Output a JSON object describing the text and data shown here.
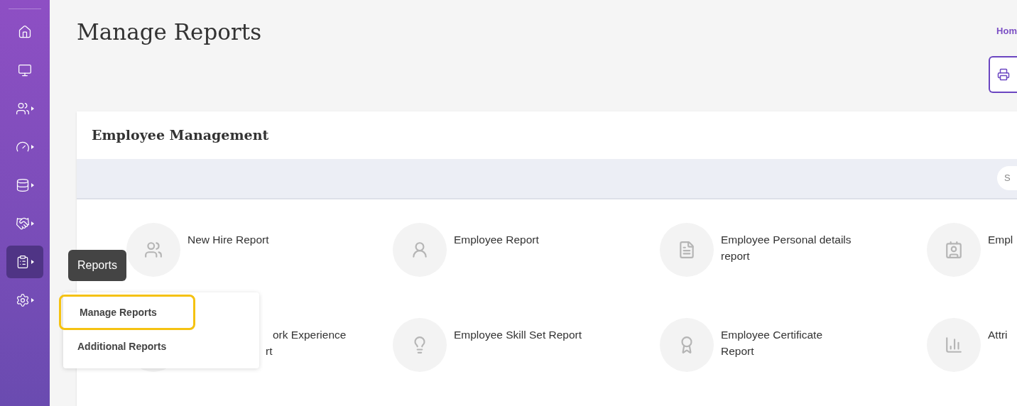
{
  "sidebar": {
    "items": [
      {
        "selected": false
      },
      {
        "selected": false
      },
      {
        "selected": false
      },
      {
        "selected": false
      },
      {
        "selected": false
      },
      {
        "selected": false
      },
      {
        "selected": true
      },
      {
        "selected": false
      }
    ]
  },
  "tooltip": "Reports",
  "flyout": {
    "items": [
      {
        "label": "Manage Reports",
        "selected": true
      },
      {
        "label": "Additional Reports",
        "selected": false
      }
    ]
  },
  "page": {
    "title": "Manage Reports",
    "breadcrumb": "Hom"
  },
  "card": {
    "title": "Employee Management",
    "filter_text": "S"
  },
  "reports": [
    {
      "lines": [
        "New Hire Report"
      ]
    },
    {
      "lines": [
        "Employee Report"
      ]
    },
    {
      "lines": [
        "Employee Personal details",
        "report"
      ]
    },
    {
      "lines": [
        "Empl"
      ]
    },
    {
      "lines": [
        "ork Experience",
        "rt"
      ]
    },
    {
      "lines": [
        "Employee Skill Set Report"
      ]
    },
    {
      "lines": [
        "Employee Certificate",
        "Report"
      ]
    },
    {
      "lines": [
        "Attri"
      ]
    }
  ]
}
